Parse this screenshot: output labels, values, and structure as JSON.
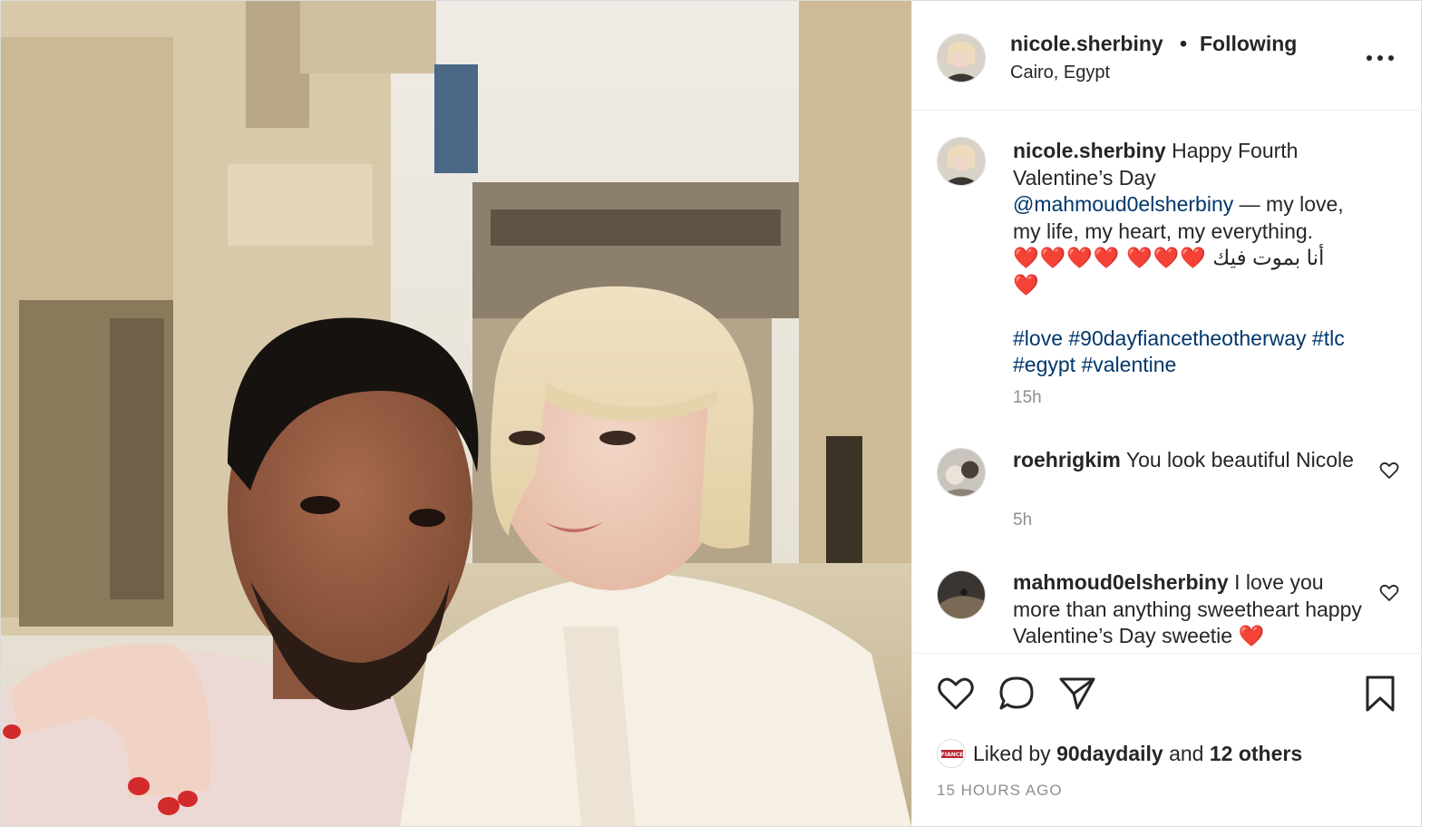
{
  "header": {
    "username": "nicole.sherbiny",
    "separator": "•",
    "follow_status": "Following",
    "location": "Cairo, Egypt"
  },
  "caption": {
    "username": "nicole.sherbiny",
    "text_1": "Happy Fourth Valentine’s Day",
    "mention": "@mahmoud0elsherbiny",
    "text_2": "— my love, my life, my heart, my everything.",
    "hearts_1": "❤️❤️❤️❤️",
    "hearts_2": "❤️❤️❤️",
    "arabic": "أنا بموت فيك",
    "hearts_3": "❤️",
    "hashtags": [
      "#love",
      "#90dayfiancetheotherway",
      "#tlc",
      "#egypt",
      "#valentine"
    ],
    "time": "15h"
  },
  "comments": [
    {
      "username": "roehrigkim",
      "text": "You look beautiful Nicole",
      "time": "5h"
    },
    {
      "username": "mahmoud0elsherbiny",
      "text": "I love you more than anything sweetheart happy Valentine’s Day sweetie",
      "hearts": "❤️"
    }
  ],
  "likes": {
    "prefix": "Liked by",
    "user": "90daydaily",
    "middle": "and",
    "others": "12 others",
    "mini_avatar_text": "FIANCE"
  },
  "timestamp": "15 HOURS AGO",
  "icons": {
    "more": "more-options-icon",
    "like": "heart-icon",
    "comment": "comment-icon",
    "share": "share-icon",
    "save": "bookmark-icon"
  },
  "colors": {
    "text": "#262626",
    "secondary": "#8e8e8e",
    "link": "#00376b",
    "border": "#dbdbdb",
    "heart": "#e0245e"
  }
}
